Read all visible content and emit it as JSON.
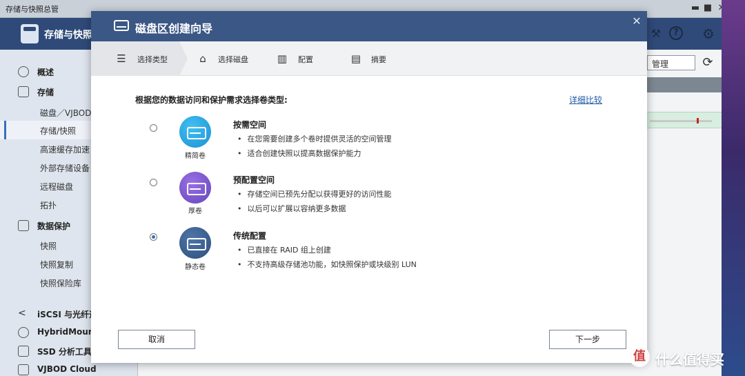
{
  "window": {
    "title": "存储与快照总管",
    "minimize": "▬",
    "maximize": "■",
    "close": "✕"
  },
  "app": {
    "title": "存储与快照"
  },
  "header_icons": {
    "user_settings": "⚒",
    "help": "?",
    "settings": "⚙"
  },
  "sidebar": {
    "items": [
      {
        "label": "概述",
        "type": "top"
      },
      {
        "label": "存储",
        "type": "top"
      },
      {
        "label": "磁盘／VJBOD",
        "type": "sub"
      },
      {
        "label": "存储/快照",
        "type": "sub",
        "active": true
      },
      {
        "label": "高速缓存加速",
        "type": "sub"
      },
      {
        "label": "外部存储设备",
        "type": "sub"
      },
      {
        "label": "远程磁盘",
        "type": "sub"
      },
      {
        "label": "拓扑",
        "type": "sub"
      },
      {
        "label": "数据保护",
        "type": "top"
      },
      {
        "label": "快照",
        "type": "sub"
      },
      {
        "label": "快照复制",
        "type": "sub"
      },
      {
        "label": "快照保险库",
        "type": "sub"
      },
      {
        "label": "iSCSI 与光纤通",
        "type": "top"
      },
      {
        "label": "HybridMount",
        "type": "top"
      },
      {
        "label": "SSD 分析工具",
        "type": "top"
      },
      {
        "label": "VJBOD Cloud",
        "type": "top"
      }
    ]
  },
  "main": {
    "manage_button": "管理"
  },
  "modal": {
    "title": "磁盘区创建向导",
    "close": "✕",
    "steps": [
      {
        "label": "选择类型",
        "icon": "list-icon"
      },
      {
        "label": "选择磁盘",
        "icon": "disk-icon"
      },
      {
        "label": "配置",
        "icon": "config-icon"
      },
      {
        "label": "摘要",
        "icon": "summary-icon"
      }
    ],
    "prompt": "根据您的数据访问和保护需求选择卷类型:",
    "detail_link": "详细比较",
    "options": [
      {
        "name": "精简卷",
        "title": "按需空间",
        "bullets": [
          "在您需要创建多个卷时提供灵活的空间管理",
          "适合创建快照以提高数据保护能力"
        ],
        "selected": false
      },
      {
        "name": "厚卷",
        "title": "预配置空间",
        "bullets": [
          "存储空间已预先分配以获得更好的访问性能",
          "以后可以扩展以容纳更多数据"
        ],
        "selected": false
      },
      {
        "name": "静态卷",
        "title": "传统配置",
        "bullets": [
          "已直接在 RAID 组上创建",
          "不支持高级存储池功能，如快照保护或块级别 LUN"
        ],
        "selected": true
      }
    ],
    "cancel": "取消",
    "next": "下一步"
  },
  "watermark": {
    "logo": "值",
    "text": "什么值得买"
  }
}
